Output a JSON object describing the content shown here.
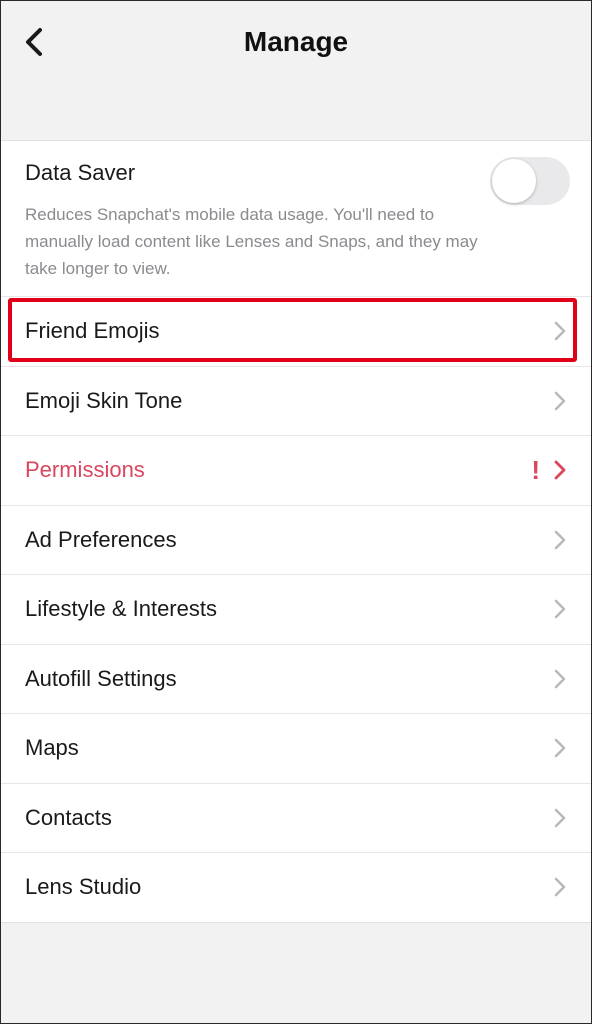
{
  "header": {
    "title": "Manage",
    "back_icon": "chevron-left-icon"
  },
  "data_saver": {
    "title": "Data Saver",
    "description": "Reduces Snapchat's mobile data usage. You'll need to manually load content like Lenses and Snaps, and they may take longer to view.",
    "enabled": false
  },
  "items": [
    {
      "label": "Friend Emojis",
      "icon": "chevron-right-icon"
    },
    {
      "label": "Emoji Skin Tone",
      "icon": "chevron-right-icon"
    },
    {
      "label": "Permissions",
      "icon": "chevron-right-icon",
      "alert": "!"
    },
    {
      "label": "Ad Preferences",
      "icon": "chevron-right-icon"
    },
    {
      "label": "Lifestyle & Interests",
      "icon": "chevron-right-icon"
    },
    {
      "label": "Autofill Settings",
      "icon": "chevron-right-icon"
    },
    {
      "label": "Maps",
      "icon": "chevron-right-icon"
    },
    {
      "label": "Contacts",
      "icon": "chevron-right-icon"
    },
    {
      "label": "Lens Studio",
      "icon": "chevron-right-icon"
    }
  ],
  "colors": {
    "background": "#f2f2f3",
    "alert": "#d9465e",
    "highlight": "#e0001a",
    "chevron": "#b8b8bd"
  }
}
